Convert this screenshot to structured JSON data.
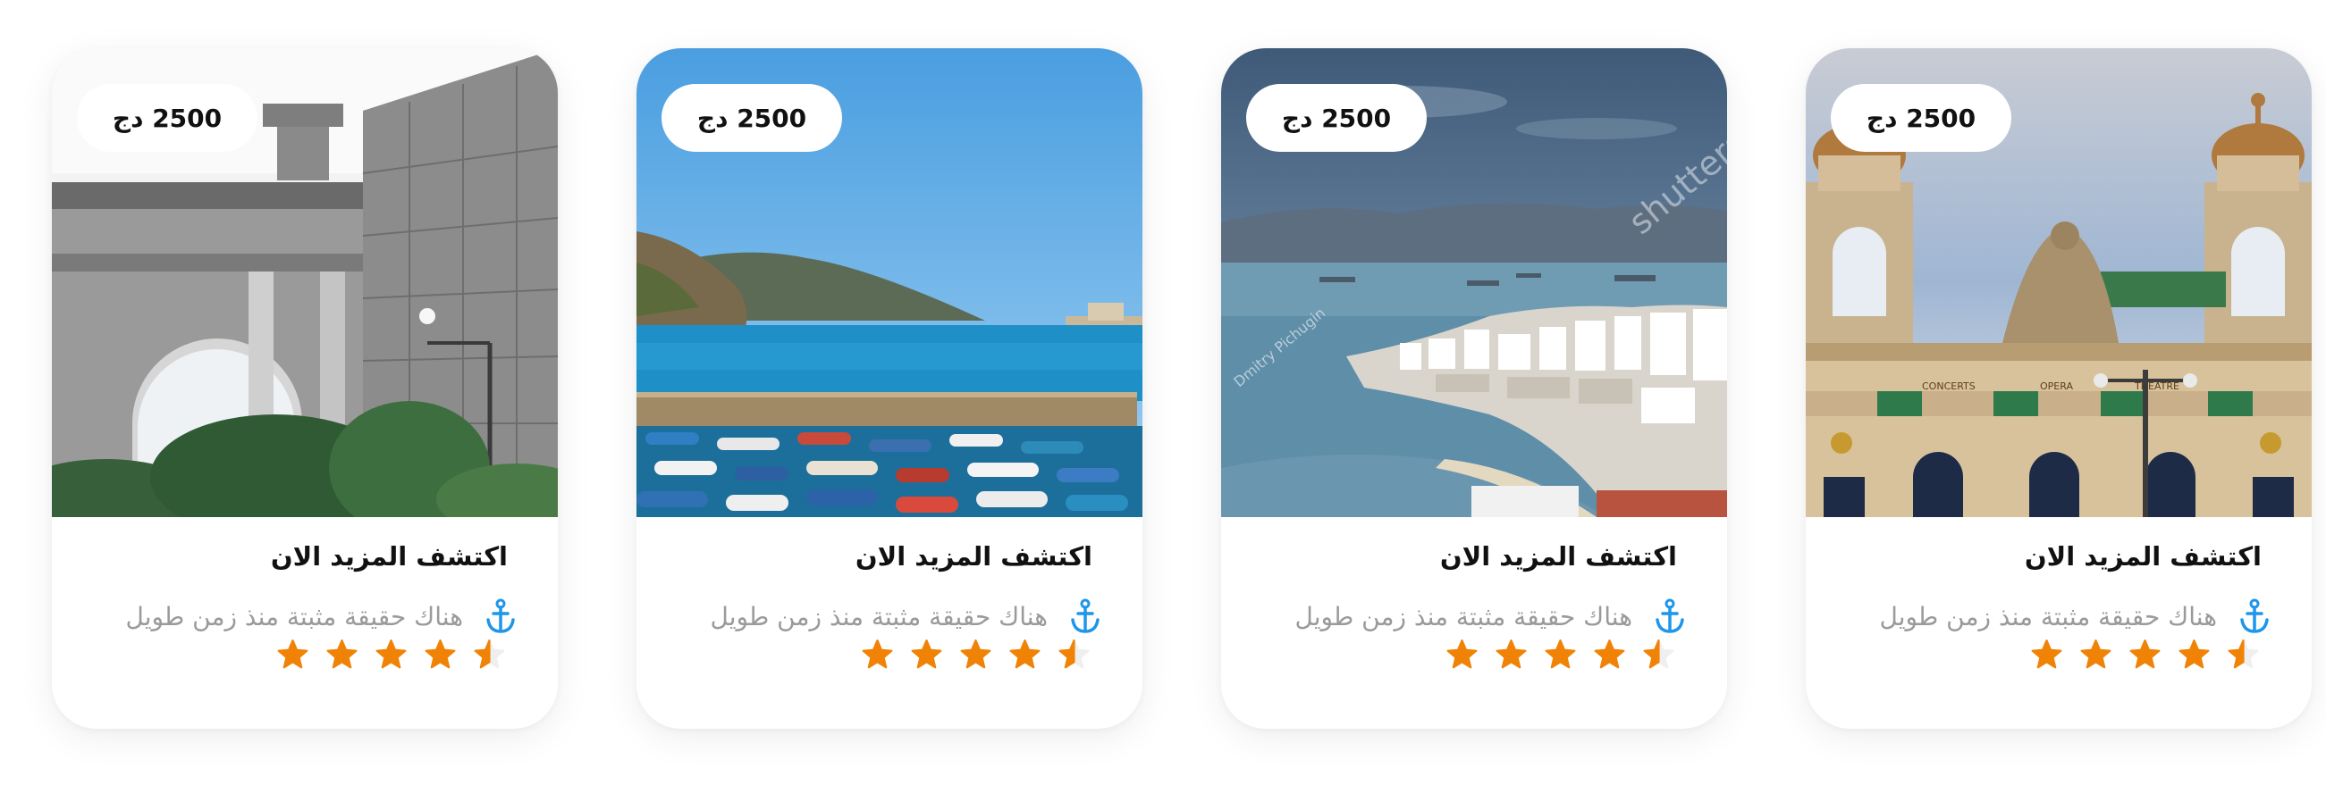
{
  "colors": {
    "star": "#f08306",
    "star_empty": "#efefef",
    "anchor": "#1e96e9",
    "description": "#9a9a9a"
  },
  "cards": [
    {
      "scene": "roman-arch-ruins",
      "price": "2500 دج",
      "title": "اكتشف المزيد الان",
      "description": "هناك حقيقة مثبتة منذ زمن طويل",
      "location_icon": "anchor-icon",
      "rating": 4.5
    },
    {
      "scene": "harbor-boats",
      "price": "2500 دج",
      "title": "اكتشف المزيد الان",
      "description": "هناك حقيقة مثبتة منذ زمن طويل",
      "location_icon": "anchor-icon",
      "rating": 4.5
    },
    {
      "scene": "coastal-city-bay",
      "price": "2500 دج",
      "title": "اكتشف المزيد الان",
      "description": "هناك حقيقة مثبتة منذ زمن طويل",
      "location_icon": "anchor-icon",
      "rating": 4.5,
      "image_watermarks": [
        "shutterstock",
        "Dmitry Pichugin"
      ]
    },
    {
      "scene": "opera-facade",
      "price": "2500 دج",
      "title": "اكتشف المزيد الان",
      "description": "هناك حقيقة مثبتة منذ زمن طويل",
      "location_icon": "anchor-icon",
      "rating": 4.5,
      "image_signage": [
        "CONCERTS",
        "OPERA",
        "THEATRE"
      ]
    }
  ]
}
